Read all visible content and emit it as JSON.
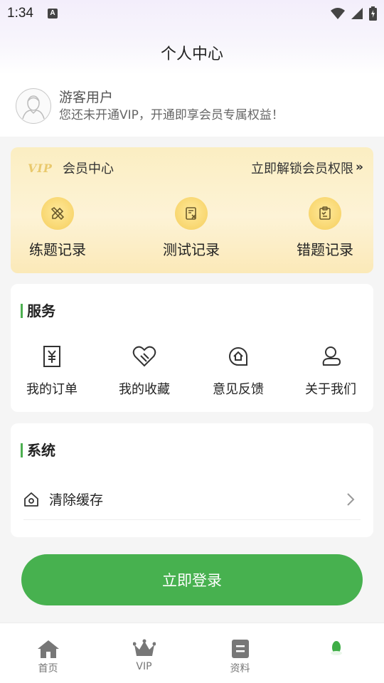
{
  "status_bar": {
    "time": "1:34",
    "notification_letter": "A"
  },
  "header": {
    "title": "个人中心"
  },
  "user": {
    "name": "游客用户",
    "subtitle": "您还未开通VIP，开通即享会员专属权益！"
  },
  "vip": {
    "badge": "VIP",
    "center_label": "会员中心",
    "unlock_label": "立即解锁会员权限",
    "items": [
      {
        "label": "练题记录",
        "icon": "pencil-ruler-icon"
      },
      {
        "label": "测试记录",
        "icon": "test-paper-icon"
      },
      {
        "label": "错题记录",
        "icon": "clipboard-x-icon"
      }
    ]
  },
  "services": {
    "title": "服务",
    "items": [
      {
        "label": "我的订单",
        "icon": "yuan-receipt-icon"
      },
      {
        "label": "我的收藏",
        "icon": "heart-icon"
      },
      {
        "label": "意见反馈",
        "icon": "feedback-icon"
      },
      {
        "label": "关于我们",
        "icon": "info-icon"
      }
    ]
  },
  "system": {
    "title": "系统",
    "items": [
      {
        "label": "清除缓存",
        "icon": "home-icon"
      }
    ]
  },
  "login_button": "立即登录",
  "tabs": [
    {
      "label": "首页",
      "icon": "home-icon"
    },
    {
      "label": "VIP",
      "icon": "crown-icon"
    },
    {
      "label": "资料",
      "icon": "document-icon"
    },
    {
      "label": "",
      "icon": "profile-icon",
      "active": true
    }
  ],
  "colors": {
    "accent_green": "#47b14f",
    "vip_gold": "#f8d66f",
    "background": "#f5f5f5"
  }
}
